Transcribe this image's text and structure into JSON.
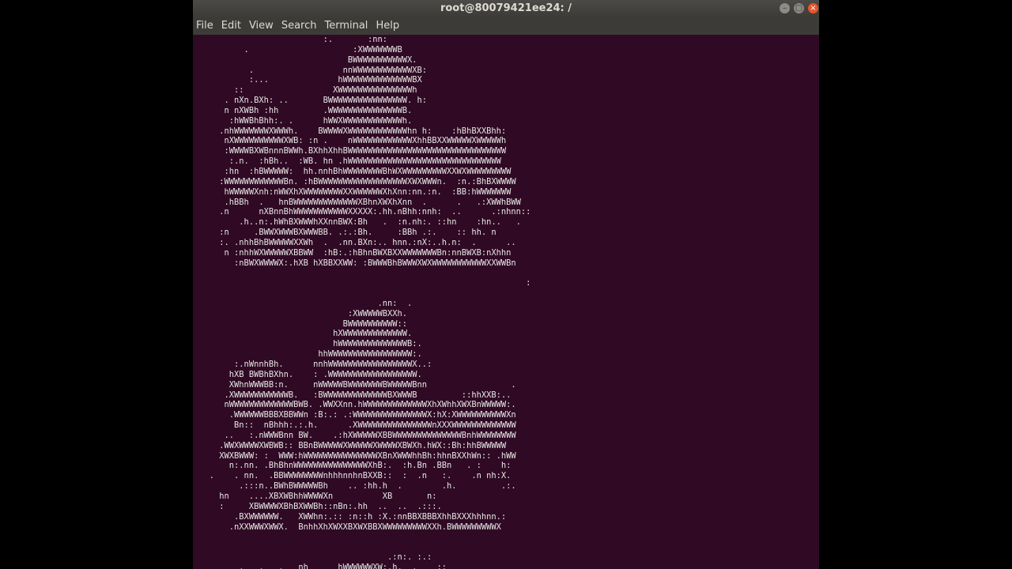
{
  "window": {
    "title": "root@80079421ee24: /",
    "controls": {
      "minimize": "–",
      "maximize": "□",
      "close": "×"
    }
  },
  "menu": {
    "file": "File",
    "edit": "Edit",
    "view": "View",
    "search": "Search",
    "terminal": "Terminal",
    "help": "Help"
  },
  "terminal": {
    "output": "                          :.       :nn:\n          .                     :XWWWWWWWB\n                               BWWWWWWWWWWWX.\n           .                  nnWWWWWWWWWWWWXB:\n           :...              hWWWWWWWWWWWWWWBX\n        ::                  XWWWWWWWWWWWWWWWh\n      . nXn.BXh: ..       BWWWWWWWWWWWWWWWW. h:\n      n nXWBh :hh         .WWWWWWWWWWWWWWWB.\n       :hWWBhBhh:. .      hWWXWWWWWWWWWWWWh.\n     .nhWWWWWWWXWWWh.    BWWWWXWWWWWWWWWWWWhn h:    :hBhBXXBhh:\n      nXWWWWWWWWWWXWB: :n .    nWWWWWWWWWWWWXhhBBXXWWWWWXWWWWWh\n      :WWWWBXWBnnnBWWh.BXhhXhhBWWWWWWWWWWWWWWWWWWWWWWWWWWWWWWWW\n       :.n.  :hBh..  :WB. hn .hWWWWWWWWWWWWWWWWWWWWWWWWWWWWWWW\n      :hn  :hBWWWWW:  hh.nnhBhWWWWWWWWBhWXWWWWWWWWWXXWXWWWWWWWWW\n     :WWWWWWWWWWWWBn. :hBWWWWWWWWWWWWWWWWWWXWXWWWn.  :n.:BhBXWWWW\n      hWWWWWXnh:nWWXhXWWWWWWWWXXWWWWWWXhXnn:nn.:n.  :BB:hWWWWWWW\n      .hBBh  .   hnBWWWWWWWWWWWWWXBhnXWXhXnn  .      .   .:XWWhBWW\n     .n      nXBnnBhWWWWWWWWWWWXXXXX:.hh.nBhh:nnh:  ..      .:nhnn::\n         .h..n:.hWhBXWWWhXXnnBWX:Bh   .  :n.nh:. ::hn    :hn..   .\n     :n     .BWWXWWWBXWWWBB. .:.:Bh.     :BBh .:.    :: hh. n\n     :. .nhhBhBWWWWWXXWh  .  .nn.BXn:.. hnn.:nX:..h.n:  .      ..\n      n :nhhWXWWWWWXBBWW  :hB:.:hBhnBWXBXXWWWWWWWBn:nnBWXB:nXhhn\n        :nBWXWWWWX:.hXB hXBBXXWW: :BWWWBhBWWWXWXWWWWWWWWWWWXXWWBn\n\n                                                                   :\n\n                                     .nn:  .\n                               :XWWWWWBXXh.\n                              BWWWWWWWWWW::\n                            hXWWWWWWWWWWWWW.\n                            hWWWWWWWWWWWWWWB:.\n                         hhWWWWWWWWWWWWWWWWW:.\n        :.nWnnhBh.      nnhWWWWWWWWWWWWWWWWWX..:\n       hXB BWBhBXhn.    : .WWWWWWWWWWWWWWWWWW.\n       XWhnWWWBB:n.     nWWWWWBWWWWWWWBWWWWWBnn                 .\n      .XWWWWWWWWWWWB.   :BWWWWWWWWWWWWWBXWWWB         ::hhXXB:..\n      nWWWWWWWWWWWWWBWB. .WWXXnn.hWWWWWWWWWWWWWXhXWhhXWXBnWWWWW:.\n       .WWWWWWBBBXBBWWn :B:.: .:WWWWWWWWWWWWWWWX:hX:XWWWWWWWWWWXn\n        Bn::  nBhhh:.:.h.      .XWWWWWWWWWWWWWWWnXXXWWWWWWWWWWWWW\n      ..   :.nWWWBnn BW.    .:hXWWWWWXBBWWWWWWWWWWWWWWBnhWWWWWWWW\n     .WWXWWWWXWBWB:: BBnBWWWWWXWWWWWXWWWWXBWXh.hWX::Bh:hhBWWWWW\n     XWXBWWW: :  WWW:hWWWWWWWWWWWWWWWXBnXWWWhhBh:hhnBXXhWn:: .hWW\n       n:.nn. .BhBhnWWWWWWWWWWWWWWWXhB:.  :h.Bn .BBn   . :    h:\n   .    . nn.  .BBWWWWWWWWnhhhnnhnBXXB::  :  .n   :.    .n nh:X.\n         .:::n..BWhBWWWWWBh    .. :hh.h  .        .h.         .:.\n     hn    ....XBXWBhhWWWWXn          XB       n:\n     :     XBWWWWXBhBXWWBh::nBn:.hh  ..  ..  .:::.\n        .BXWWWWWW.   XWWhn:.:: :n::h :X.:nnBBXBBBXhhBXXXhhhnn.:\n       .nXXWWWXWWX.  BnhhXhXWXXBXWXBBXWWWWWWWWWXXh.BWWWWWWWWWX\n\n\n                                       .:n:. :.:\n         .   .   .   nh      hWWWWWWXW:.h.  .    ::\n         .           nn   .:WWWWWWWWWWBh:        nn"
  }
}
